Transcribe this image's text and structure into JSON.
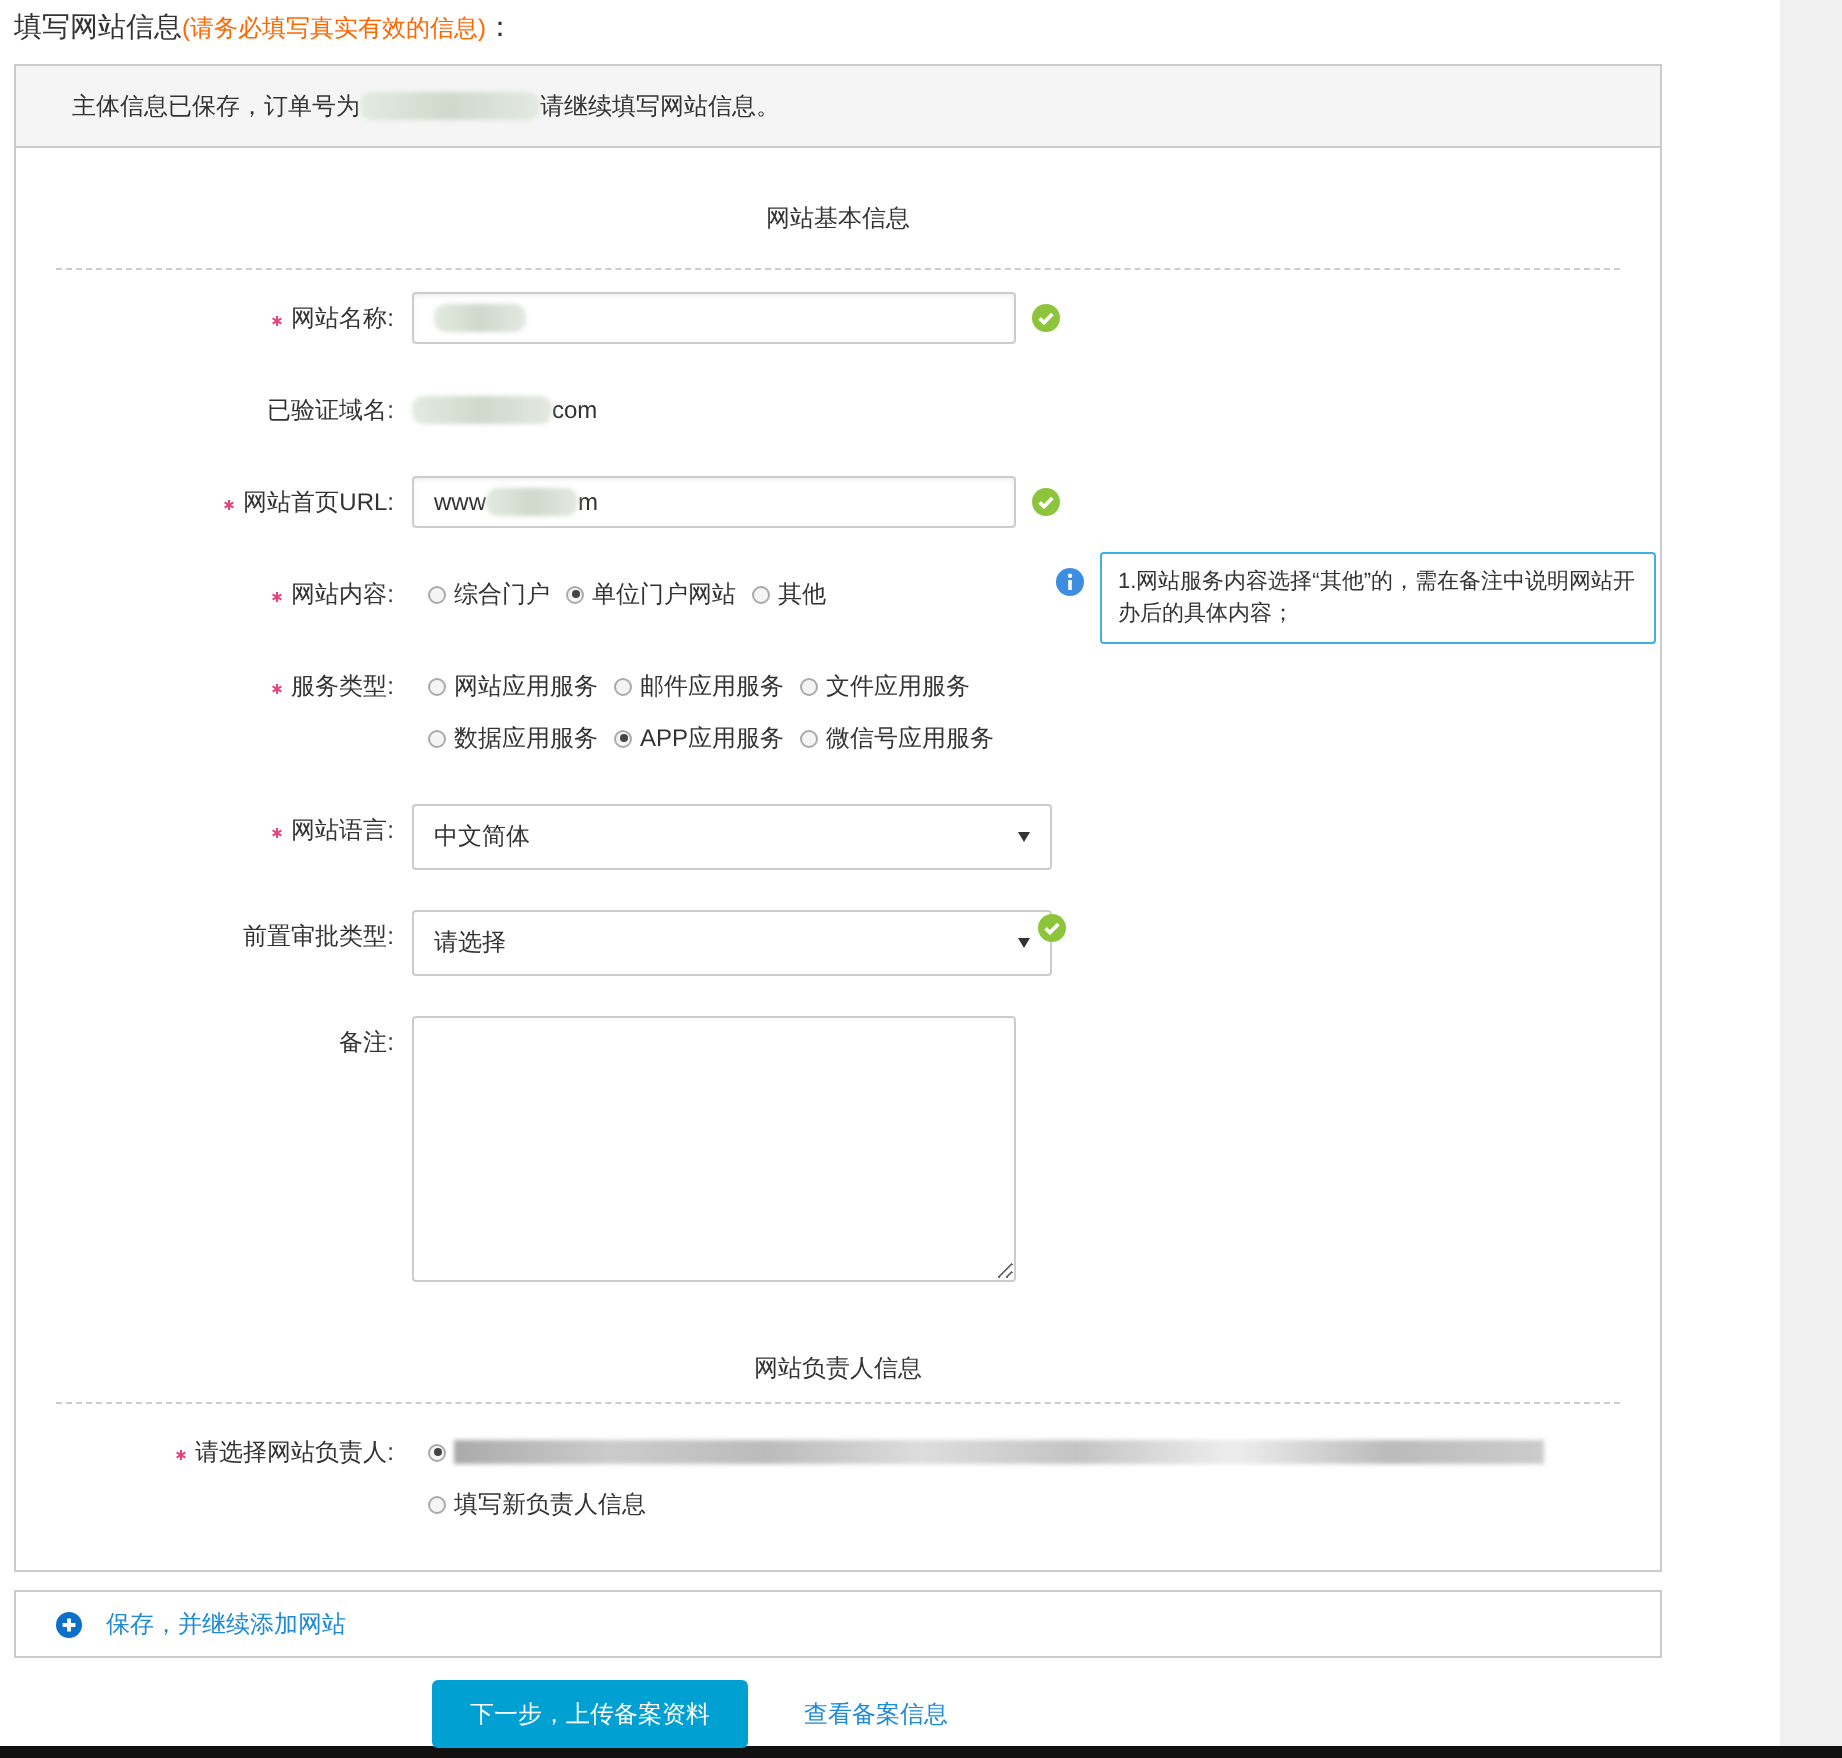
{
  "heading": {
    "title": "填写网站信息",
    "note": "(请务必填写真实有效的信息)",
    "suffix": "："
  },
  "notice": {
    "segments": [
      {
        "kind": "text",
        "text": "主体信息已保存，订单号为"
      },
      {
        "kind": "blur"
      },
      {
        "kind": "text",
        "text": "请继续填写网站信息。"
      }
    ]
  },
  "sections": [
    {
      "title": "网站基本信息",
      "fields": [
        {
          "kind": "input",
          "label": "网站名称:",
          "required": true,
          "valid": true,
          "segments": [
            {
              "kind": "blur"
            }
          ]
        },
        {
          "kind": "static",
          "label": "已验证域名:",
          "required": false,
          "segments": [
            {
              "kind": "blur"
            },
            {
              "kind": "text",
              "text": "com"
            }
          ]
        },
        {
          "kind": "input",
          "label": "网站首页URL:",
          "required": true,
          "valid": true,
          "segments": [
            {
              "kind": "text",
              "text": "www"
            },
            {
              "kind": "blur"
            },
            {
              "kind": "text",
              "text": "m"
            }
          ]
        },
        {
          "kind": "radio",
          "label": "网站内容:",
          "required": true,
          "options": [
            {
              "label": "综合门户",
              "selected": false
            },
            {
              "label": "单位门户网站",
              "selected": true
            },
            {
              "label": "其他",
              "selected": false
            }
          ],
          "tip": "1.网站服务内容选择“其他”的，需在备注中说明网站开办后的具体内容；"
        },
        {
          "kind": "radio",
          "label": "服务类型:",
          "required": true,
          "options": [
            {
              "label": "网站应用服务",
              "selected": false
            },
            {
              "label": "邮件应用服务",
              "selected": false
            },
            {
              "label": "文件应用服务",
              "selected": false
            },
            {
              "label": "数据应用服务",
              "selected": false
            },
            {
              "label": "APP应用服务",
              "selected": true
            },
            {
              "label": "微信号应用服务",
              "selected": false
            }
          ]
        },
        {
          "kind": "select",
          "label": "网站语言:",
          "required": true,
          "value": "中文简体",
          "valid": false
        },
        {
          "kind": "select",
          "label": "前置审批类型:",
          "required": false,
          "value": "请选择",
          "valid": true
        },
        {
          "kind": "textarea",
          "label": "备注:",
          "required": false
        }
      ]
    },
    {
      "title": "网站负责人信息",
      "fields": [
        {
          "kind": "radio",
          "label": "请选择网站负责人:",
          "required": true,
          "options": [
            {
              "segments": [
                {
                  "kind": "blur"
                }
              ],
              "selected": true
            },
            {
              "label": "填写新负责人信息",
              "selected": false
            }
          ]
        }
      ]
    }
  ],
  "add_link": "保存，并继续添加网站",
  "primary_button": "下一步，上传备案资料",
  "secondary_link": "查看备案信息"
}
